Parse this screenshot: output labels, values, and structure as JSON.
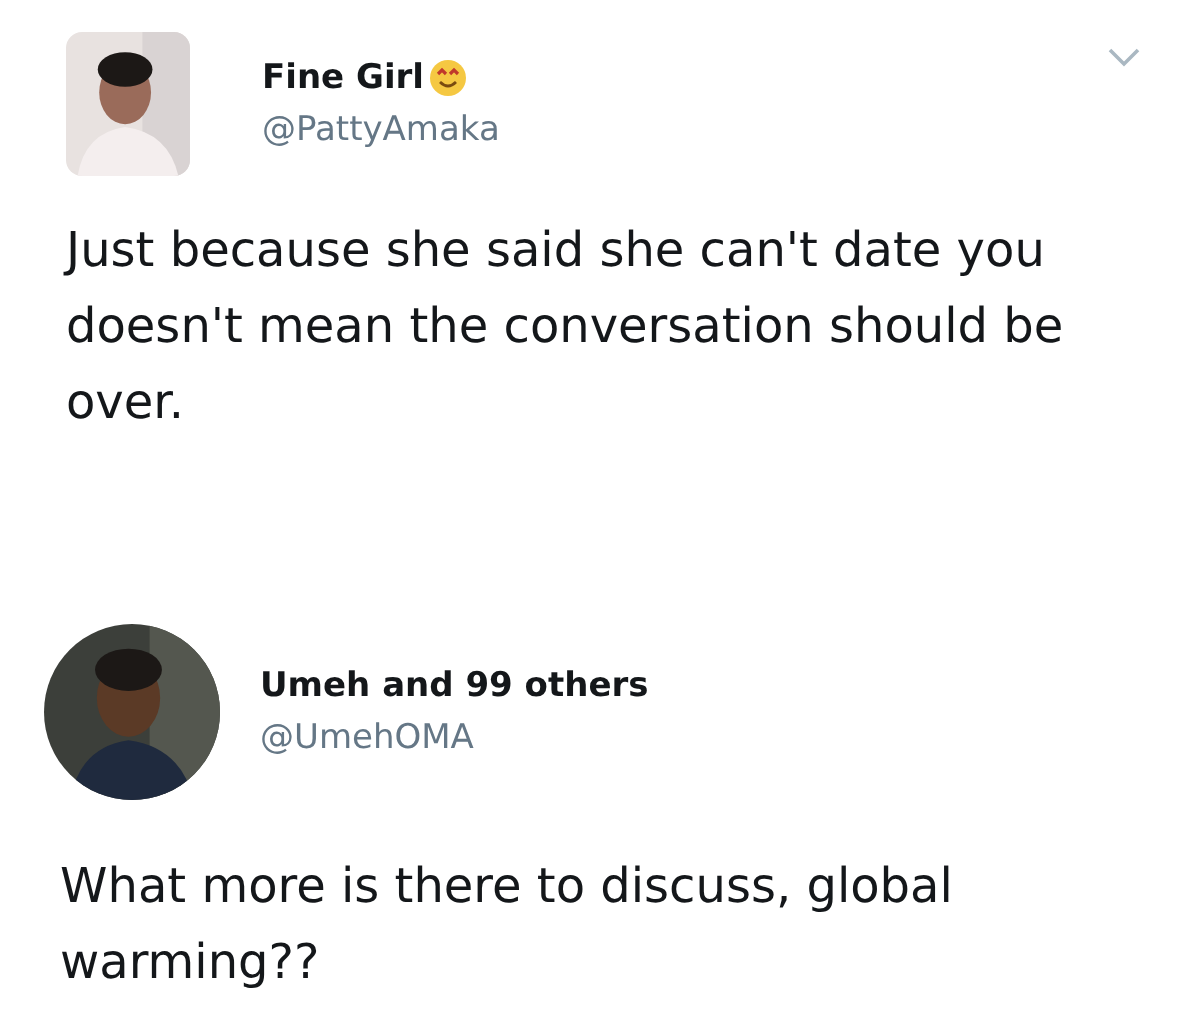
{
  "tweets": [
    {
      "name": "Fine Girl",
      "name_emoji": true,
      "handle": "@PattyAmaka",
      "text": "Just because she said she can't date you doesn't mean the conversation should be over.",
      "menu": true,
      "avatar": {
        "kind": "square"
      }
    },
    {
      "name": "Umeh and 99 others",
      "name_emoji": false,
      "handle": "@UmehOMA",
      "text": "What more is there to discuss, global warming??",
      "menu": false,
      "avatar": {
        "kind": "round"
      }
    }
  ]
}
